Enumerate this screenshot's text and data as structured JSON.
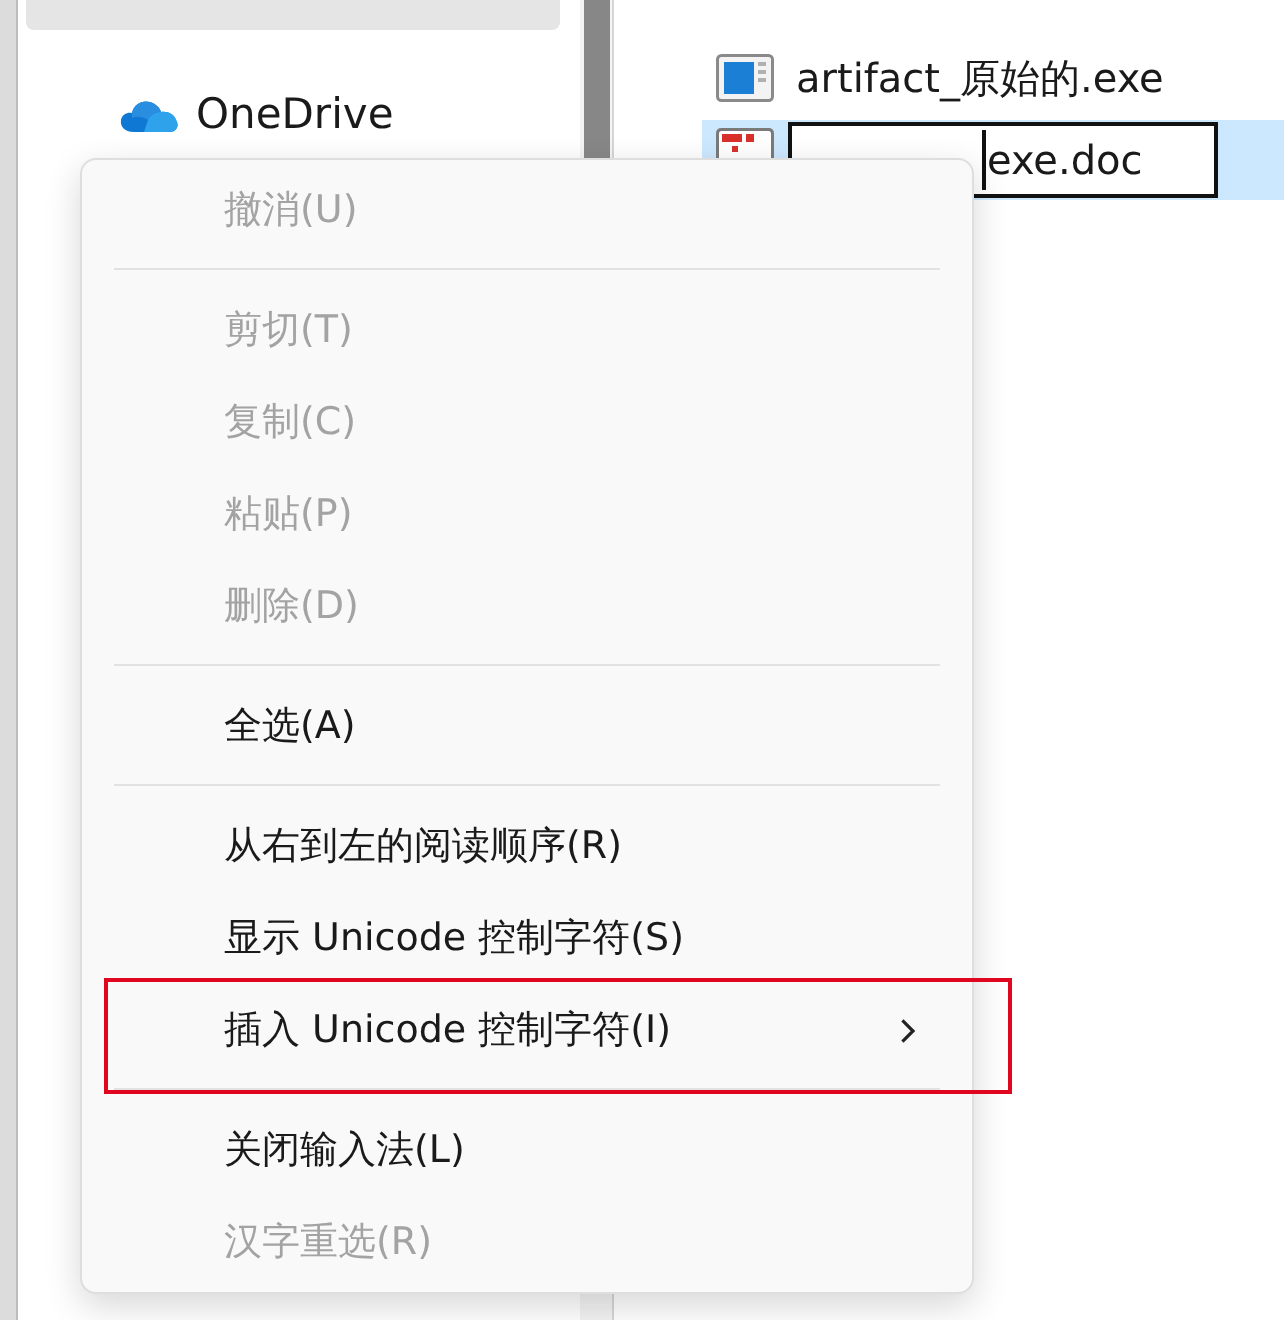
{
  "sidebar": {
    "items": [
      {
        "selected": true
      },
      {
        "label": "OneDrive",
        "selected": false
      }
    ]
  },
  "files": [
    {
      "name": "artifact_原始的.exe",
      "kind": "exe",
      "selected": false,
      "editing": false
    },
    {
      "value": "exe.doc",
      "kind": "doc",
      "selected": true,
      "editing": true
    }
  ],
  "context_menu": {
    "groups": [
      [
        {
          "label": "撤消(U)",
          "disabled": true,
          "submenu": false,
          "outlined": false
        }
      ],
      [
        {
          "label": "剪切(T)",
          "disabled": true,
          "submenu": false,
          "outlined": false
        },
        {
          "label": "复制(C)",
          "disabled": true,
          "submenu": false,
          "outlined": false
        },
        {
          "label": "粘贴(P)",
          "disabled": true,
          "submenu": false,
          "outlined": false
        },
        {
          "label": "删除(D)",
          "disabled": true,
          "submenu": false,
          "outlined": false
        }
      ],
      [
        {
          "label": "全选(A)",
          "disabled": false,
          "submenu": false,
          "outlined": false
        }
      ],
      [
        {
          "label": "从右到左的阅读顺序(R)",
          "disabled": false,
          "submenu": false,
          "outlined": false
        },
        {
          "label": "显示 Unicode 控制字符(S)",
          "disabled": false,
          "submenu": false,
          "outlined": false
        },
        {
          "label": "插入 Unicode 控制字符(I)",
          "disabled": false,
          "submenu": true,
          "outlined": true
        }
      ],
      [
        {
          "label": "关闭输入法(L)",
          "disabled": false,
          "submenu": false,
          "outlined": false
        },
        {
          "label": "汉字重选(R)",
          "disabled": true,
          "submenu": false,
          "outlined": false
        }
      ]
    ]
  }
}
